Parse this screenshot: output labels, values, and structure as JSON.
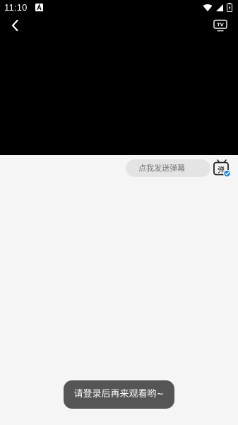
{
  "status_bar": {
    "time": "11:10",
    "notification_icon": "font-a-icon",
    "icons": [
      "wifi-icon",
      "signal-icon",
      "battery-icon"
    ]
  },
  "player": {
    "back_icon": "chevron-left-icon",
    "cast_icon": "tv-icon",
    "cast_label": "TV"
  },
  "danmaku": {
    "placeholder": "点我发送弹幕",
    "toggle_icon": "danmaku-toggle-icon",
    "toggle_label": "弹"
  },
  "toast": {
    "message": "请登录后再来观看哟~"
  },
  "colors": {
    "video_background": "#000000",
    "page_background": "#f5f5f5",
    "input_background": "#e4e4e4",
    "accent": "#1e88e5",
    "toast_background": "#555555"
  }
}
